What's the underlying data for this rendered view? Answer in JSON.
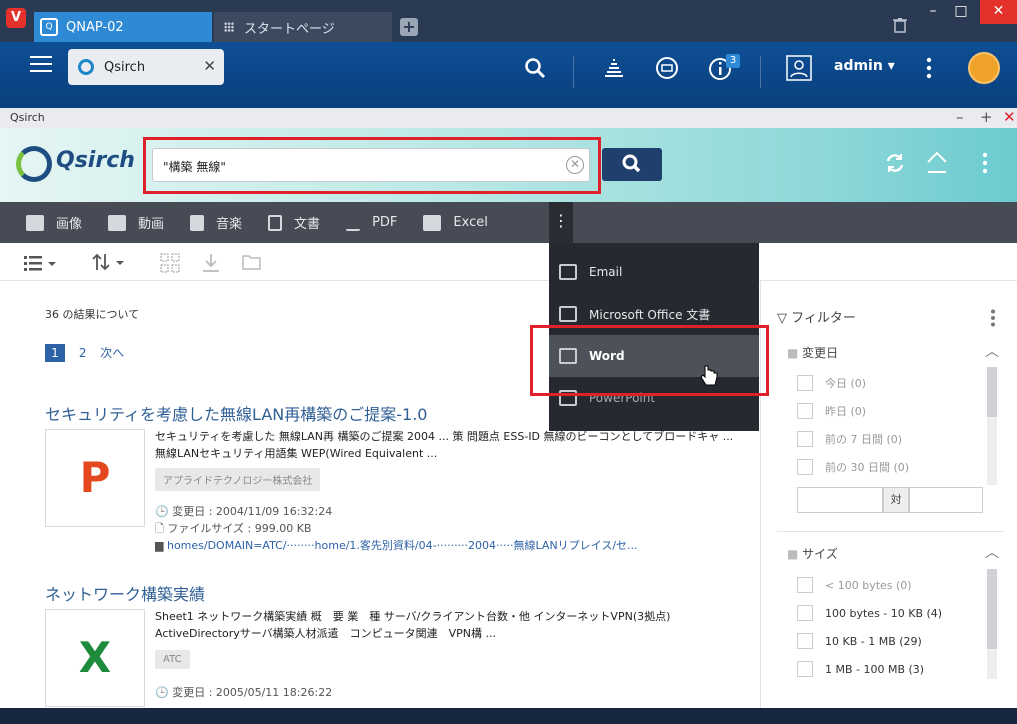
{
  "browser": {
    "logo": "V",
    "tab1": "QNAP-02",
    "tab2": "スタートページ",
    "newtab": "+",
    "min": "–",
    "max": "□",
    "close": "✕"
  },
  "qts": {
    "app_tab": "Qsirch",
    "app_tab_close": "✕",
    "info_badge": "3",
    "user": "admin ▾"
  },
  "window": {
    "title": "Qsirch",
    "min": "–",
    "max": "+",
    "close": "✕"
  },
  "search": {
    "logo": "Qsirch",
    "query": "\"構築 無線\""
  },
  "categories": [
    "画像",
    "動画",
    "音楽",
    "文書",
    "PDF",
    "Excel"
  ],
  "more_button": "⋮",
  "dropdown": {
    "items": [
      "Email",
      "Microsoft Office 文書",
      "Word",
      "PowerPoint"
    ]
  },
  "results": {
    "count": "36 の結果について",
    "pages": [
      "1",
      "2",
      "次へ"
    ],
    "items": [
      {
        "title": "セキュリティを考慮した無線LAN再構築のご提案-1.0",
        "thumb": "P",
        "thumb_color": "#e4481f",
        "snippet1": "セキュリティを考慮した 無線LAN再 構築のご提案 2004 ... 策 問題点 ESS-ID 無線のビーコンとしてブロードキャ ...",
        "snippet2": "無線LANセキュリティ用語集 WEP(Wired Equivalent ...",
        "tag": "アプライドテクノロジー株式会社",
        "modified": "変更日 : 2004/11/09 16:32:24",
        "size": "ファイルサイズ : 999.00 KB",
        "path": "homes/DOMAIN=ATC/········home/1.客先別資料/04-·········2004·····無線LANリプレイス/セ..."
      },
      {
        "title": "ネットワーク構築実績",
        "thumb": "X",
        "thumb_color": "#1e8a3c",
        "snippet1": "Sheet1 ネットワーク構築実績 概　要 業　種 サーバ/クライアント台数・他 インターネットVPN(3拠点)",
        "snippet2": "ActiveDirectoryサーバ構築人材派遣　コンピュータ関連　VPN構 ...",
        "tag": "ATC",
        "modified": "変更日 : 2005/05/11 18:26:22"
      }
    ]
  },
  "filter": {
    "title": "フィルター",
    "sec1": "変更日",
    "opts1": [
      "今日 (0)",
      "昨日 (0)",
      "前の 7 日間 (0)",
      "前の 30 日間 (0)"
    ],
    "range_sep": "対",
    "sec2": "サイズ",
    "opts2": [
      "< 100 bytes (0)",
      "100 bytes - 10 KB (4)",
      "10 KB - 1 MB (29)",
      "1 MB - 100 MB (3)"
    ]
  }
}
